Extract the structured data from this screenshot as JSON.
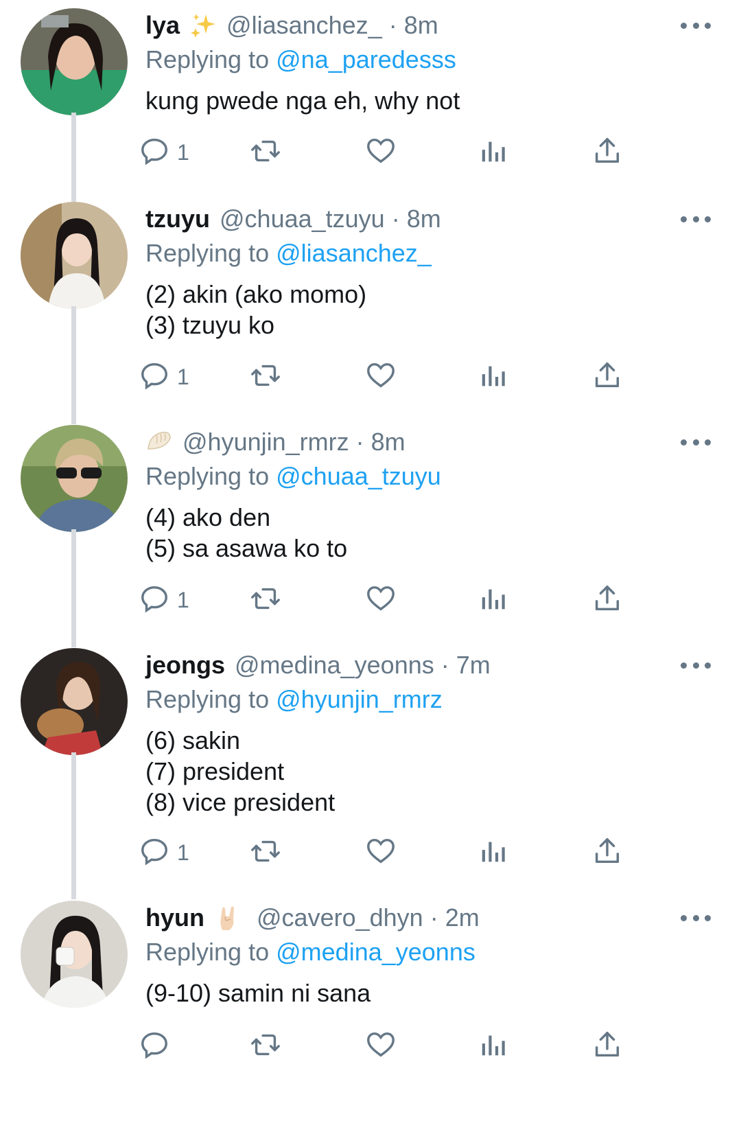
{
  "tweets": [
    {
      "display_name": "lya",
      "emoji": "sparkles-emoji",
      "handle": "@liasanchez_",
      "sep": "·",
      "time": "8m",
      "replying_prefix": "Replying to",
      "replying_to": "@na_paredesss",
      "lines": [
        "kung pwede nga eh, why not"
      ],
      "reply_count": "1"
    },
    {
      "display_name": "tzuyu",
      "emoji": "",
      "handle": "@chuaa_tzuyu",
      "sep": "·",
      "time": "8m",
      "replying_prefix": "Replying to",
      "replying_to": "@liasanchez_",
      "lines": [
        "(2) akin (ako momo)",
        "(3) tzuyu ko"
      ],
      "reply_count": "1"
    },
    {
      "display_name": "",
      "emoji": "dumpling-emoji",
      "handle": "@hyunjin_rmrz",
      "sep": "·",
      "time": "8m",
      "replying_prefix": "Replying to",
      "replying_to": "@chuaa_tzuyu",
      "lines": [
        "(4) ako den",
        "(5) sa asawa ko to"
      ],
      "reply_count": "1"
    },
    {
      "display_name": "jeongs",
      "emoji": "",
      "handle": "@medina_yeonns",
      "sep": "·",
      "time": "7m",
      "replying_prefix": "Replying to",
      "replying_to": "@hyunjin_rmrz",
      "lines": [
        "(6) sakin",
        "(7) president",
        "(8) vice president"
      ],
      "reply_count": "1"
    },
    {
      "display_name": "hyun",
      "emoji": "rock-on-hand-emoji",
      "handle": "@cavero_dhyn",
      "sep": "·",
      "time": "2m",
      "replying_prefix": "Replying to",
      "replying_to": "@medina_yeonns",
      "lines": [
        "(9-10) samin ni sana"
      ],
      "reply_count": ""
    }
  ],
  "colors": {
    "text": "#14171a",
    "secondary": "#657786",
    "link": "#1da1f2",
    "thread_line": "#d7dbdf"
  },
  "icons": [
    "reply-icon",
    "retweet-icon",
    "like-icon",
    "analytics-icon",
    "share-icon",
    "more-icon"
  ]
}
